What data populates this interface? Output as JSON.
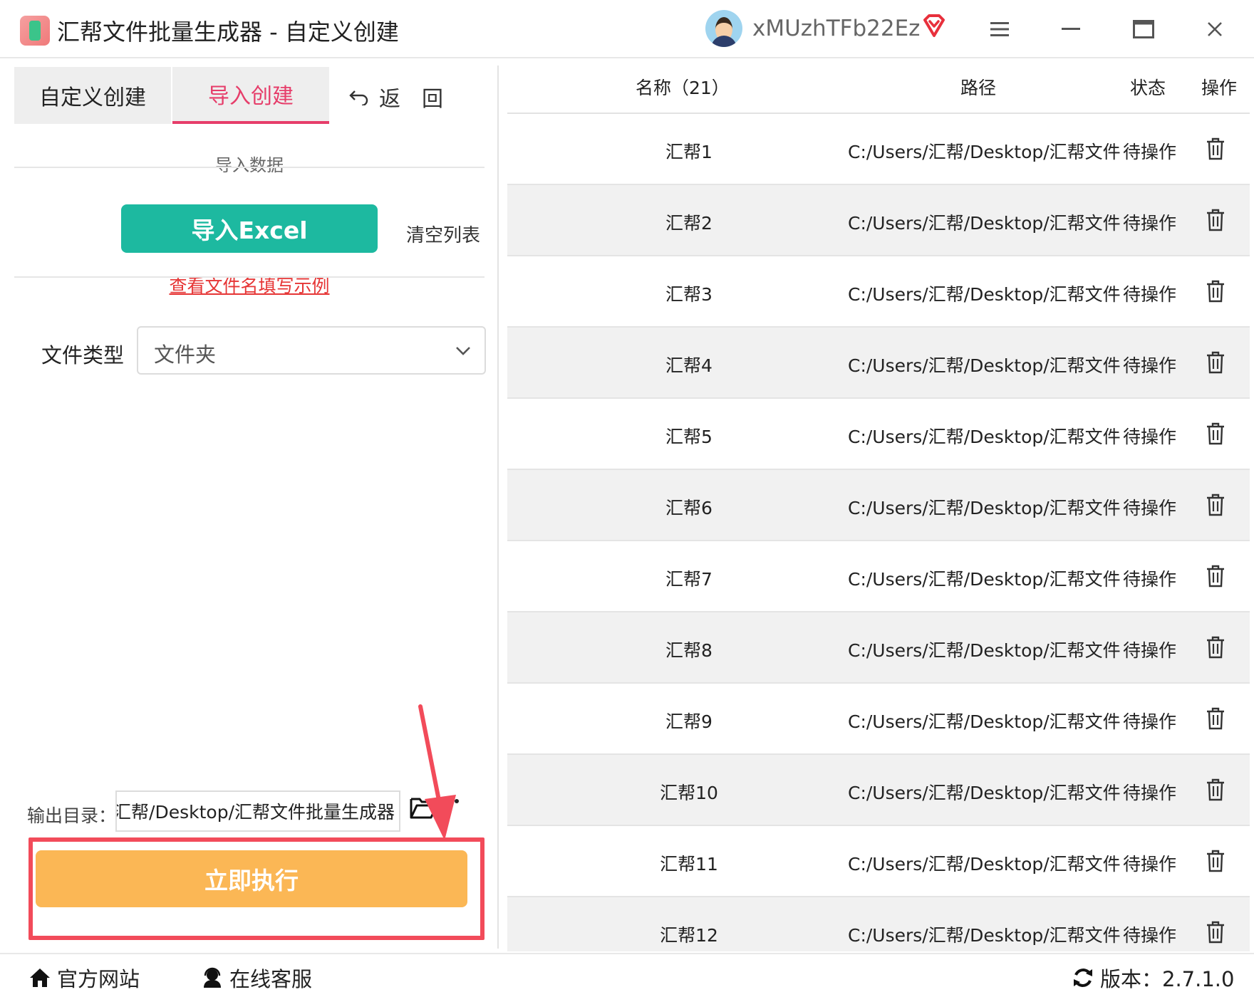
{
  "window": {
    "title": "汇帮文件批量生成器 - 自定义创建",
    "username": "xMUzhTFb22Ez",
    "icons": {
      "app": "app-logo-icon",
      "avatar": "user-avatar",
      "vip": "vip-diamond-icon",
      "menu": "hamburger-menu-icon",
      "minimize": "minimize-icon",
      "maximize": "maximize-icon",
      "close": "close-icon"
    }
  },
  "left": {
    "tabs": [
      {
        "label": "自定义创建",
        "active": false
      },
      {
        "label": "导入创建",
        "active": true
      }
    ],
    "back_label": "返　回",
    "section_title": "导入数据",
    "import_button": "导入Excel",
    "clear_list": "清空列表",
    "example_link": "查看文件名填写示例",
    "file_type_label": "文件类型",
    "file_type_value": "文件夹",
    "output_label": "输出目录：",
    "output_path": "汇帮/Desktop/汇帮文件批量生成器",
    "execute_button": "立即执行"
  },
  "table": {
    "headers": {
      "name": "名称（21）",
      "path": "路径",
      "status": "状态",
      "action": "操作"
    },
    "rows": [
      {
        "name": "汇帮1",
        "path": "C:/Users/汇帮/Desktop/汇帮文件",
        "status": "待操作"
      },
      {
        "name": "汇帮2",
        "path": "C:/Users/汇帮/Desktop/汇帮文件",
        "status": "待操作"
      },
      {
        "name": "汇帮3",
        "path": "C:/Users/汇帮/Desktop/汇帮文件",
        "status": "待操作"
      },
      {
        "name": "汇帮4",
        "path": "C:/Users/汇帮/Desktop/汇帮文件",
        "status": "待操作"
      },
      {
        "name": "汇帮5",
        "path": "C:/Users/汇帮/Desktop/汇帮文件",
        "status": "待操作"
      },
      {
        "name": "汇帮6",
        "path": "C:/Users/汇帮/Desktop/汇帮文件",
        "status": "待操作"
      },
      {
        "name": "汇帮7",
        "path": "C:/Users/汇帮/Desktop/汇帮文件",
        "status": "待操作"
      },
      {
        "name": "汇帮8",
        "path": "C:/Users/汇帮/Desktop/汇帮文件",
        "status": "待操作"
      },
      {
        "name": "汇帮9",
        "path": "C:/Users/汇帮/Desktop/汇帮文件",
        "status": "待操作"
      },
      {
        "name": "汇帮10",
        "path": "C:/Users/汇帮/Desktop/汇帮文件",
        "status": "待操作"
      },
      {
        "name": "汇帮11",
        "path": "C:/Users/汇帮/Desktop/汇帮文件",
        "status": "待操作"
      },
      {
        "name": "汇帮12",
        "path": "C:/Users/汇帮/Desktop/汇帮文件",
        "status": "待操作"
      }
    ]
  },
  "footer": {
    "website": "官方网站",
    "service": "在线客服",
    "version": "版本：2.7.1.0"
  },
  "colors": {
    "accent_tab": "#e63d6a",
    "import_button": "#1db9a0",
    "execute_button": "#fbb755",
    "highlight": "#f24b5a",
    "link": "#e63535"
  }
}
